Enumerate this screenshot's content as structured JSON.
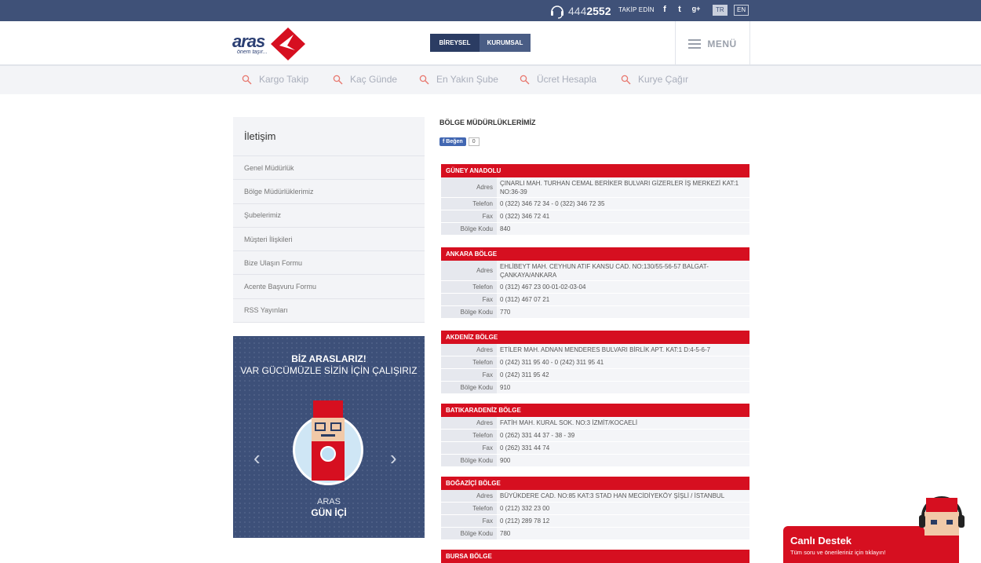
{
  "topbar": {
    "phone_prefix": "444",
    "phone_suffix": "2552",
    "follow_label": "TAKİP EDİN",
    "social": [
      {
        "icon": "facebook-icon",
        "glyph": "f"
      },
      {
        "icon": "twitter-icon",
        "glyph": "t"
      },
      {
        "icon": "google-plus-icon",
        "glyph": "g+"
      }
    ],
    "languages": [
      "TR",
      "EN"
    ],
    "active_language": "TR"
  },
  "header": {
    "logo_text": "aras",
    "logo_tagline": "önem taşır...",
    "segment_individual": "BİREYSEL",
    "segment_corporate": "KURUMSAL",
    "menu_label": "MENÜ"
  },
  "quicknav": [
    "Kargo Takip",
    "Kaç Günde",
    "En Yakın Şube",
    "Ücret Hesapla",
    "Kurye Çağır"
  ],
  "sidebar": {
    "title": "İletişim",
    "items": [
      "Genel Müdürlük",
      "Bölge Müdürlüklerimiz",
      "Şubelerimiz",
      "Müşteri İlişkileri",
      "Bize Ulaşın Formu",
      "Acente Başvuru Formu",
      "RSS Yayınları"
    ]
  },
  "banner": {
    "headline": "BİZ ARASLARIZ!",
    "subline": "VAR GÜCÜMÜZLE SİZİN İÇİN ÇALIŞIRIZ",
    "brand_line1": "ARAS",
    "brand_line2": "GÜN İÇİ",
    "prev_glyph": "‹",
    "next_glyph": "›"
  },
  "main": {
    "title": "BÖLGE MÜDÜRLÜKLERİMİZ",
    "like_label": "Beğen",
    "like_count": "0",
    "field_labels": {
      "address": "Adres",
      "phone": "Telefon",
      "fax": "Fax",
      "code": "Bölge Kodu"
    },
    "regions": [
      {
        "name": "GÜNEY ANADOLU",
        "address": "ÇINARLI MAH. TURHAN CEMAL BERİKER BULVARI GİZERLER İŞ MERKEZİ KAT:1 NO:36-39",
        "phone": "0 (322) 346 72 34 - 0 (322) 346 72 35",
        "fax": "0 (322) 346 72 41",
        "code": "840"
      },
      {
        "name": "ANKARA BÖLGE",
        "address": "EHLİBEYT MAH. CEYHUN ATIF KANSU CAD. NO:130/55-56-57 BALGAT-ÇANKAYA/ANKARA",
        "phone": "0 (312) 467 23 00-01-02-03-04",
        "fax": "0 (312) 467 07 21",
        "code": "770"
      },
      {
        "name": "AKDENİZ BÖLGE",
        "address": "ETİLER MAH. ADNAN MENDERES BULVARI BİRLİK APT. KAT:1 D:4-5-6-7",
        "phone": "0 (242) 311 95 40 - 0 (242) 311 95 41",
        "fax": "0 (242) 311 95 42",
        "code": "910"
      },
      {
        "name": "BATIKARADENİZ BÖLGE",
        "address": "FATİH MAH. KURAL SOK. NO:3 İZMİT/KOCAELİ",
        "phone": "0 (262) 331 44 37 - 38 - 39",
        "fax": "0 (262) 331 44 74",
        "code": "900"
      },
      {
        "name": "BOĞAZİÇİ BÖLGE",
        "address": "BÜYÜKDERE CAD. NO:85 KAT:3 STAD HAN MECİDİYEKÖY ŞİŞLİ / İSTANBUL",
        "phone": "0 (212) 332 23 00",
        "fax": "0 (212) 289 78 12",
        "code": "780"
      },
      {
        "name": "BURSA BÖLGE"
      }
    ]
  },
  "live_support": {
    "title": "Canlı Destek",
    "subtitle": "Tüm soru ve önerileriniz için tıklayın!"
  },
  "colors": {
    "topbar": "#3f5178",
    "accent_red": "#d60f20",
    "brand_navy": "#2b3c63"
  }
}
